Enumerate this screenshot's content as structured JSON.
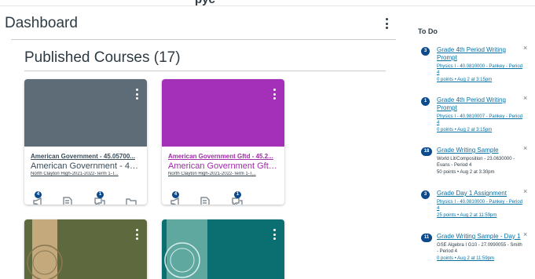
{
  "top_fragment": "pyc",
  "dashboard": {
    "title": "Dashboard",
    "menu_icon": "vertical-ellipsis-icon"
  },
  "section": {
    "title": "Published Courses (17)"
  },
  "cards": [
    {
      "color": "#5e6c78",
      "link": "American Government - 45.05700...",
      "name": "American Government - 45.05...",
      "term": "North Clayton High-2021-2022-Term 1-T...",
      "link_color": "#394b58",
      "name_color": "#394b58",
      "announcements": "4",
      "discussions": "1"
    },
    {
      "color": "#a42fb8",
      "link": "American Government Gftd - 45.2...",
      "name": "American Government Gftd - ...",
      "term": "North Clayton High-2021-2022-Term 1-T...",
      "link_color": "#9f2aa9",
      "name_color": "#9f2aa9",
      "announcements": "4",
      "discussions": "1"
    },
    {
      "color": "#5e6a3e",
      "accent": "#c4a97c"
    },
    {
      "color": "#0b6e70",
      "accent": "#5fa8a0"
    }
  ],
  "todo": {
    "title": "To Do",
    "items": [
      {
        "badge": "3",
        "assignment": "Grade 4th Period Writing Prompt",
        "course": "Physics I - 40.0810000 - Pankey - Period 4",
        "meta": "0 points • Aug 2 at 3:15pm"
      },
      {
        "badge": "1",
        "assignment": "Grade 4th Period Writing Prompt",
        "course": "Physics I - 40.9810007 - Pankey - Period 4",
        "meta": "0 points • Aug 2 at 3:15pm"
      },
      {
        "badge": "18",
        "assignment": "Grade Writing Sample",
        "course": "World Lit/Composition - 23.0630000 - Evans - Period 4",
        "meta": "50 points • Aug 2 at 3:30pm"
      },
      {
        "badge": "3",
        "assignment": "Grade Day 1 Assignment",
        "course": "Physics I - 40.0810000 - Pankey - Period 4",
        "meta": "25 points • Aug 2 at 11:59pm"
      },
      {
        "badge": "11",
        "assignment": "Grade Writing Sample - Day 1",
        "course": "GSE Algebra I G10 - 27.0990055 - Smith - Period 4",
        "meta": "0 points • Aug 2 at 11:59pm"
      }
    ],
    "close_symbol": "×"
  },
  "icons": {
    "announcement": "megaphone-icon",
    "assignment": "assignment-icon",
    "discussion": "discussion-icon",
    "files": "folder-icon"
  }
}
